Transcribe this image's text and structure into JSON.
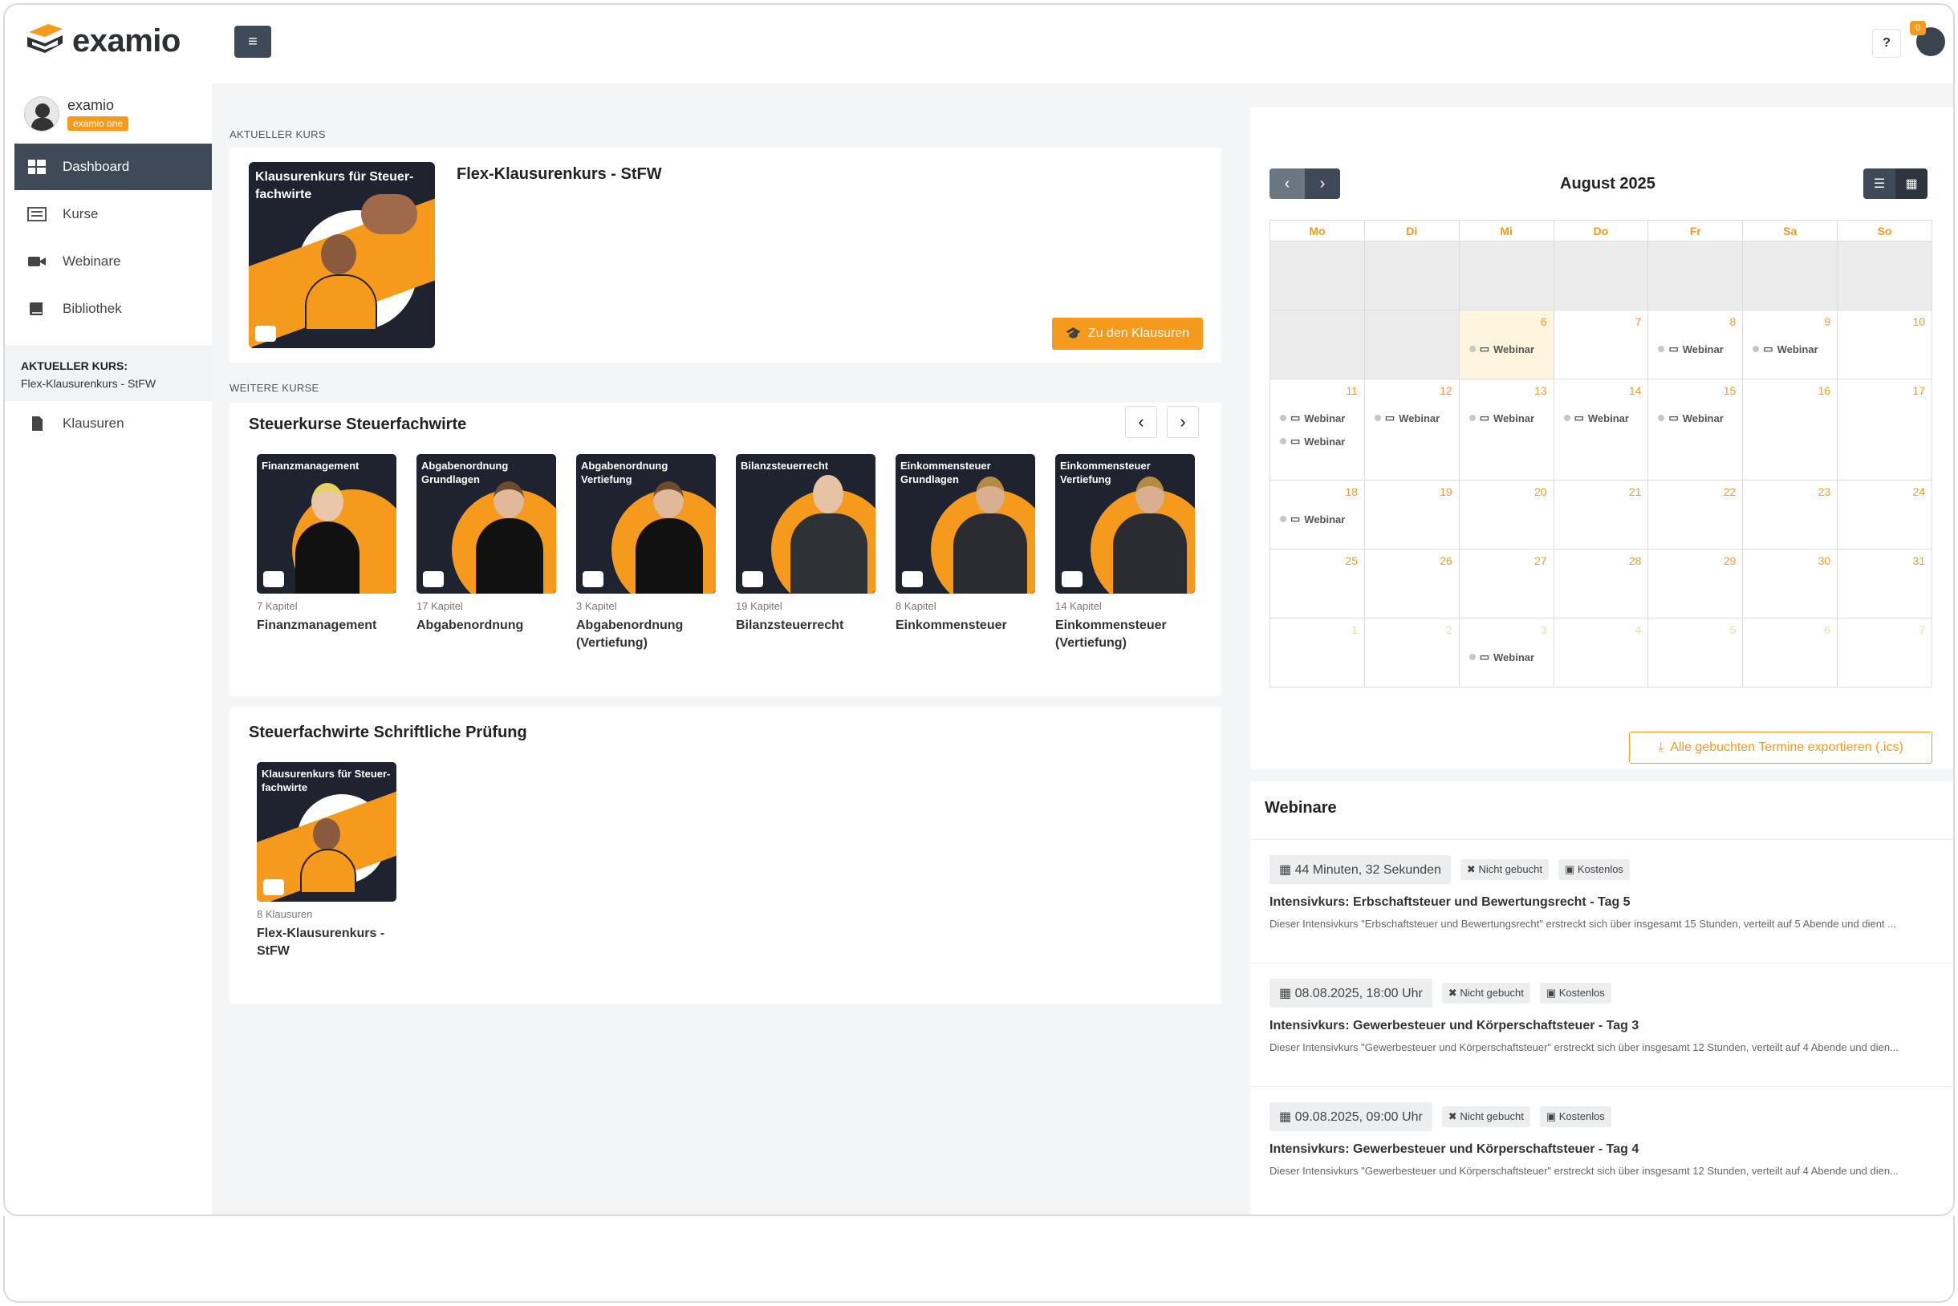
{
  "app": {
    "name": "examio"
  },
  "header": {
    "help_label": "?",
    "notification_count": "0"
  },
  "profile": {
    "name": "examio",
    "plan_badge": "examio one"
  },
  "sidebar": {
    "items": [
      {
        "label": "Dashboard",
        "icon": "dashboard-icon"
      },
      {
        "label": "Kurse",
        "icon": "list-icon"
      },
      {
        "label": "Webinare",
        "icon": "video-icon"
      },
      {
        "label": "Bibliothek",
        "icon": "book-icon"
      }
    ],
    "current_course_heading": "AKTUELLER KURS:",
    "current_course_name": "Flex-Klausurenkurs - StFW",
    "sub_items": [
      {
        "label": "Klausuren",
        "icon": "file-icon"
      }
    ]
  },
  "main": {
    "current_label": "AKTUELLER KURS",
    "current_course": {
      "thumb_text": "Klausurenkurs für Steuer-fachwirte",
      "title": "Flex-Klausurenkurs - StFW",
      "button": "Zu den Klausuren"
    },
    "more_label": "WEITERE KURSE",
    "group1": {
      "title": "Steuerkurse Steuerfachwirte",
      "courses": [
        {
          "thumb": "Finanzmanagement",
          "count": "7 Kapitel",
          "name": "Finanzmanagement"
        },
        {
          "thumb": "Abgabenordnung Grundlagen",
          "count": "17 Kapitel",
          "name": "Abgabenordnung"
        },
        {
          "thumb": "Abgabenordnung Vertiefung",
          "count": "3 Kapitel",
          "name": "Abgabenordnung (Vertiefung)"
        },
        {
          "thumb": "Bilanzsteuerrecht",
          "count": "19 Kapitel",
          "name": "Bilanzsteuerrecht"
        },
        {
          "thumb": "Einkommensteuer Grundlagen",
          "count": "8 Kapitel",
          "name": "Einkommensteuer"
        },
        {
          "thumb": "Einkommensteuer Vertiefung",
          "count": "14 Kapitel",
          "name": "Einkommensteuer (Vertiefung)"
        }
      ]
    },
    "group2": {
      "title": "Steuerfachwirte Schriftliche Prüfung",
      "courses": [
        {
          "thumb": "Klausurenkurs für Steuer-fachwirte",
          "count": "8 Klausuren",
          "name": "Flex-Klausurenkurs - StFW"
        }
      ]
    }
  },
  "calendar": {
    "title": "August 2025",
    "weekdays": [
      "Mo",
      "Di",
      "Mi",
      "Do",
      "Fr",
      "Sa",
      "So"
    ],
    "event_label": "Webinar",
    "weeks": [
      [
        {
          "d": ""
        },
        {
          "d": ""
        },
        {
          "d": ""
        },
        {
          "d": ""
        },
        {
          "d": ""
        },
        {
          "d": ""
        },
        {
          "d": ""
        }
      ],
      [
        {
          "d": ""
        },
        {
          "d": ""
        },
        {
          "d": "6",
          "ev": 1,
          "today": true
        },
        {
          "d": "7"
        },
        {
          "d": "8",
          "ev": 1
        },
        {
          "d": "9",
          "ev": 1
        },
        {
          "d": "10"
        }
      ],
      [
        {
          "d": "11",
          "ev": 2
        },
        {
          "d": "12",
          "ev": 1
        },
        {
          "d": "13",
          "ev": 1
        },
        {
          "d": "14",
          "ev": 1
        },
        {
          "d": "15",
          "ev": 1
        },
        {
          "d": "16"
        },
        {
          "d": "17"
        }
      ],
      [
        {
          "d": "18",
          "ev": 1
        },
        {
          "d": "19"
        },
        {
          "d": "20"
        },
        {
          "d": "21"
        },
        {
          "d": "22"
        },
        {
          "d": "23"
        },
        {
          "d": "24"
        }
      ],
      [
        {
          "d": "25"
        },
        {
          "d": "26"
        },
        {
          "d": "27"
        },
        {
          "d": "28"
        },
        {
          "d": "29"
        },
        {
          "d": "30"
        },
        {
          "d": "31"
        }
      ],
      [
        {
          "d": "1",
          "faded": true
        },
        {
          "d": "2",
          "faded": true
        },
        {
          "d": "3",
          "faded": true,
          "ev": 1
        },
        {
          "d": "4",
          "faded": true
        },
        {
          "d": "5",
          "faded": true
        },
        {
          "d": "6",
          "faded": true
        },
        {
          "d": "7",
          "faded": true
        }
      ]
    ],
    "export_button": "Alle gebuchten Termine exportieren (.ics)"
  },
  "webinars": {
    "title": "Webinare",
    "items": [
      {
        "when": "44 Minuten, 32 Sekunden",
        "status": "Nicht gebucht",
        "price": "Kostenlos",
        "title": "Intensivkurs: Erbschaftsteuer und Bewertungsrecht - Tag 5",
        "desc": "Dieser Intensivkurs \"Erbschaftsteuer und Bewertungsrecht\" erstreckt sich über insgesamt 15 Stunden, verteilt auf 5 Abende und dient ..."
      },
      {
        "when": "08.08.2025, 18:00 Uhr",
        "status": "Nicht gebucht",
        "price": "Kostenlos",
        "title": "Intensivkurs: Gewerbesteuer und Körperschaftsteuer - Tag 3",
        "desc": "Dieser Intensivkurs \"Gewerbesteuer und Körperschaftsteuer\" erstreckt sich über insgesamt 12 Stunden, verteilt auf 4 Abende und dien..."
      },
      {
        "when": "09.08.2025, 09:00 Uhr",
        "status": "Nicht gebucht",
        "price": "Kostenlos",
        "title": "Intensivkurs: Gewerbesteuer und Körperschaftsteuer - Tag 4",
        "desc": "Dieser Intensivkurs \"Gewerbesteuer und Körperschaftsteuer\" erstreckt sich über insgesamt 12 Stunden, verteilt auf 4 Abende und dien..."
      }
    ]
  }
}
